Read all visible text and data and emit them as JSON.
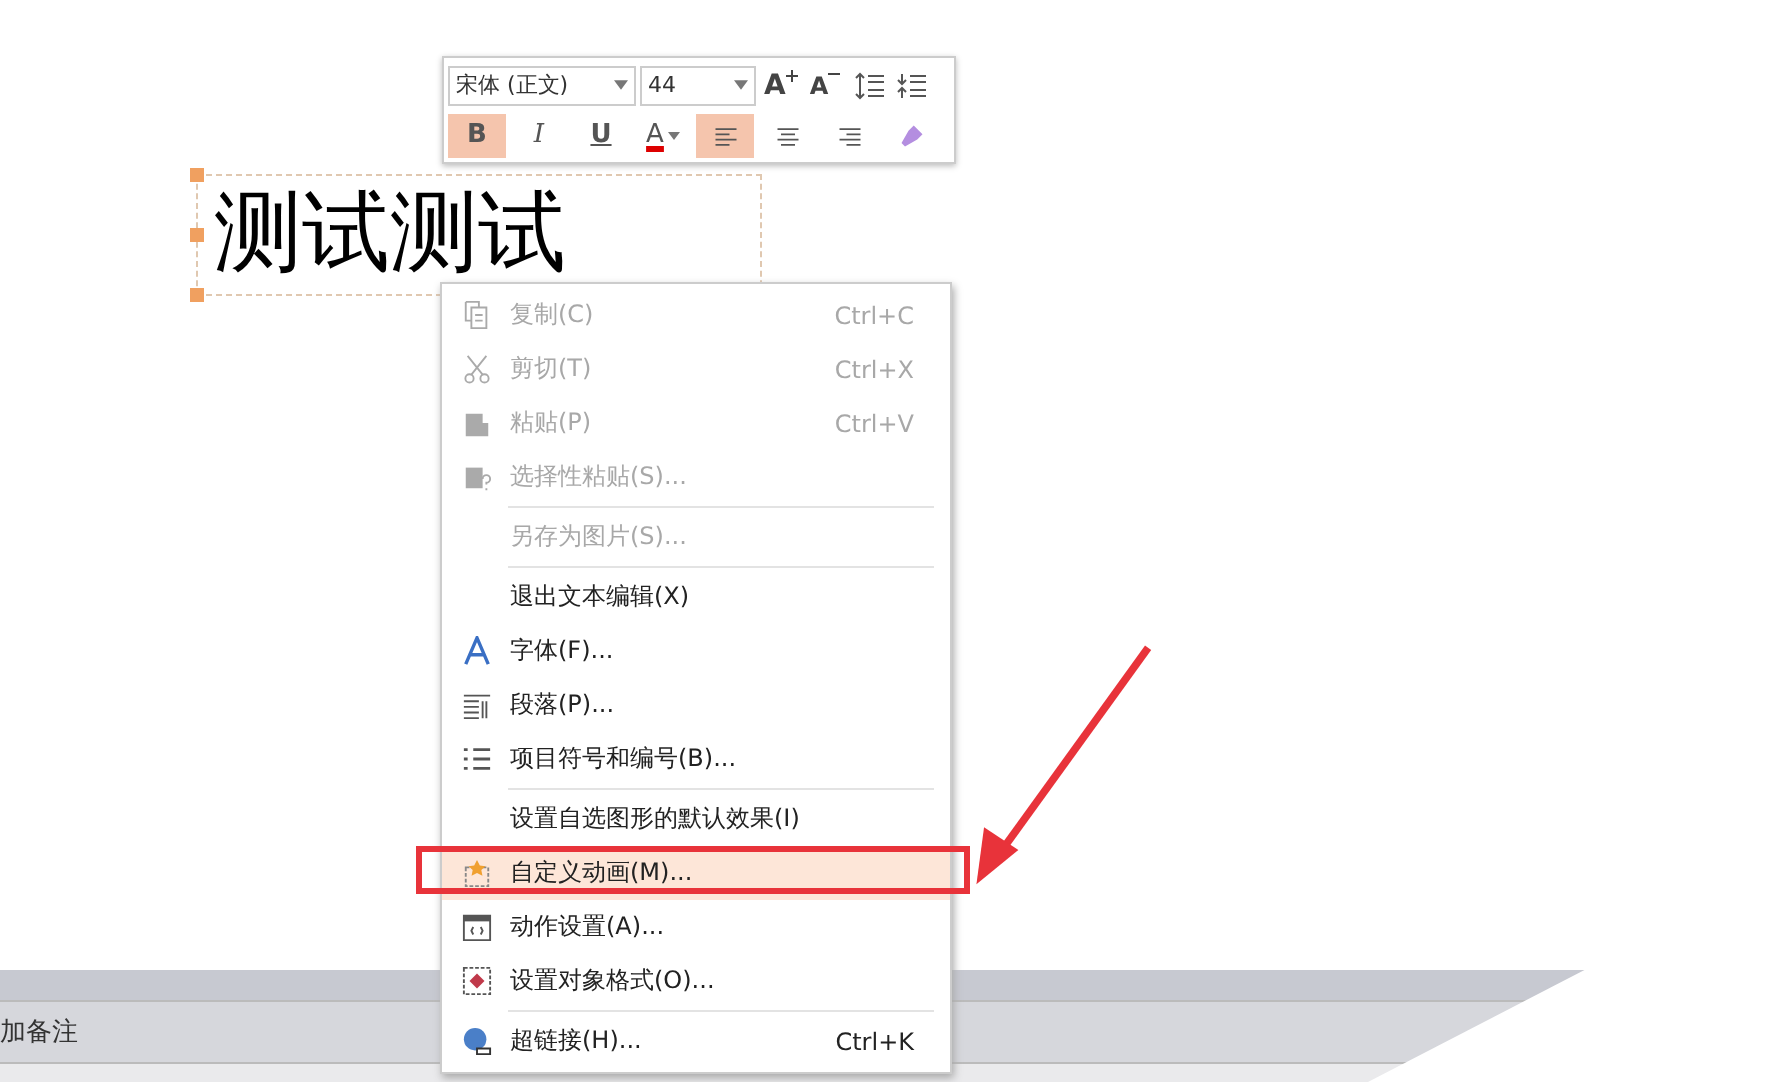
{
  "text_box": {
    "text": "测试测试"
  },
  "mini_toolbar": {
    "font": "宋体 (正文)",
    "size": "44",
    "row1": [
      {
        "kind": "grow",
        "label": "A"
      },
      {
        "kind": "shrink",
        "label": "A"
      },
      {
        "kind": "line-spacing"
      },
      {
        "kind": "para-spacing"
      }
    ],
    "row2": [
      {
        "kind": "bold",
        "label": "B",
        "selected": true
      },
      {
        "kind": "italic",
        "label": "I",
        "selected": false
      },
      {
        "kind": "underline",
        "label": "U",
        "selected": false
      },
      {
        "kind": "color",
        "label": "A",
        "selected": false
      },
      {
        "kind": "align-left",
        "selected": true
      },
      {
        "kind": "align-center",
        "selected": false
      },
      {
        "kind": "align-right",
        "selected": false
      },
      {
        "kind": "painter",
        "selected": false
      }
    ]
  },
  "context_menu": [
    {
      "kind": "copy",
      "label": "复制(C)",
      "shortcut": "Ctrl+C",
      "disabled": true,
      "selected": false
    },
    {
      "kind": "cut",
      "label": "剪切(T)",
      "shortcut": "Ctrl+X",
      "disabled": true,
      "selected": false
    },
    {
      "kind": "paste",
      "label": "粘贴(P)",
      "shortcut": "Ctrl+V",
      "disabled": true,
      "selected": false
    },
    {
      "kind": "paste-special",
      "label": "选择性粘贴(S)...",
      "disabled": true,
      "selected": false
    },
    {
      "label": "另存为图片(S)...",
      "disabled": true,
      "selected": false,
      "separator_before": true
    },
    {
      "label": "退出文本编辑(X)",
      "disabled": false,
      "selected": false,
      "separator_before": true
    },
    {
      "kind": "font",
      "label": "字体(F)...",
      "disabled": false,
      "selected": false
    },
    {
      "kind": "paragraph",
      "label": "段落(P)...",
      "disabled": false,
      "selected": false
    },
    {
      "kind": "bullets",
      "label": "项目符号和编号(B)...",
      "disabled": false,
      "selected": false
    },
    {
      "label": "设置自选图形的默认效果(I)",
      "disabled": false,
      "selected": false,
      "separator_before": true
    },
    {
      "kind": "animation",
      "label": "自定义动画(M)...",
      "disabled": false,
      "selected": true
    },
    {
      "kind": "action",
      "label": "动作设置(A)...",
      "disabled": false,
      "selected": false
    },
    {
      "kind": "format",
      "label": "设置对象格式(O)...",
      "disabled": false,
      "selected": false
    },
    {
      "kind": "hyperlink",
      "label": "超链接(H)...",
      "shortcut": "Ctrl+K",
      "disabled": false,
      "selected": false,
      "separator_before": true
    }
  ],
  "notes_bar": {
    "text": "加备注"
  }
}
